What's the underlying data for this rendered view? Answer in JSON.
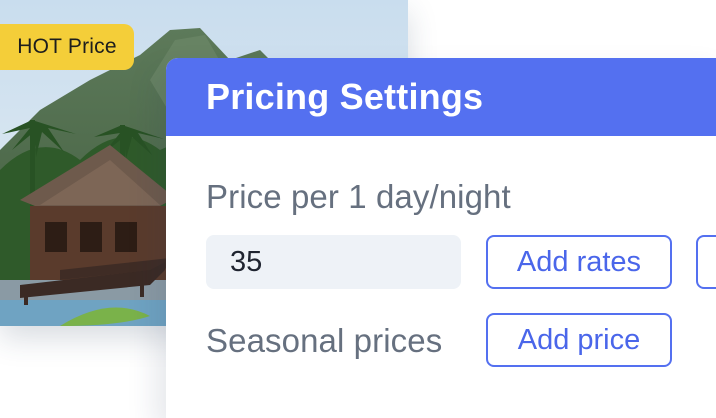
{
  "badge": {
    "label": "HOT Price"
  },
  "panel": {
    "title": "Pricing Settings",
    "price_label": "Price per 1 day/night",
    "price_value": "35",
    "add_rates_label": "Add rates",
    "seasonal_label": "Seasonal prices",
    "add_price_label": "Add price"
  },
  "colors": {
    "accent": "#5470f0",
    "badge": "#f4ce39",
    "input_bg": "#eef2f7",
    "label_text": "#66707f"
  }
}
